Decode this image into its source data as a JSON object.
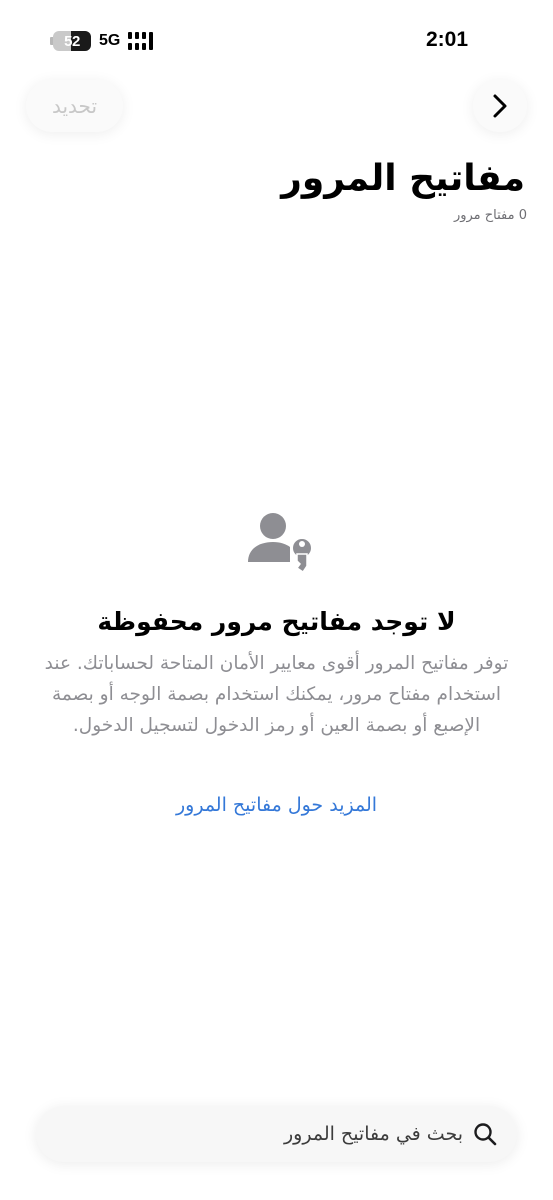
{
  "status_bar": {
    "battery_level": "52",
    "network": "5G",
    "time": "2:01"
  },
  "nav": {
    "refresh_label": "تحديد",
    "back_icon": "chevron-right-icon"
  },
  "header": {
    "title": "مفاتيح المرور",
    "count": "0 مفتاح مرور"
  },
  "empty_state": {
    "icon": "person-key-icon",
    "title": "لا توجد مفاتيح مرور محفوظة",
    "description": "توفر مفاتيح المرور أقوى معايير الأمان المتاحة لحساباتك. عند استخدام مفتاح مرور، يمكنك استخدام بصمة الوجه أو بصمة الإصبع أو بصمة العين أو رمز الدخول لتسجيل الدخول.",
    "link": "المزيد حول مفاتيح المرور"
  },
  "search": {
    "placeholder": "بحث في مفاتيح المرور",
    "icon": "search-icon"
  },
  "colors": {
    "accent": "#3478d8",
    "secondary_text": "#8e8e93",
    "icon_gray": "#8e8e93"
  }
}
